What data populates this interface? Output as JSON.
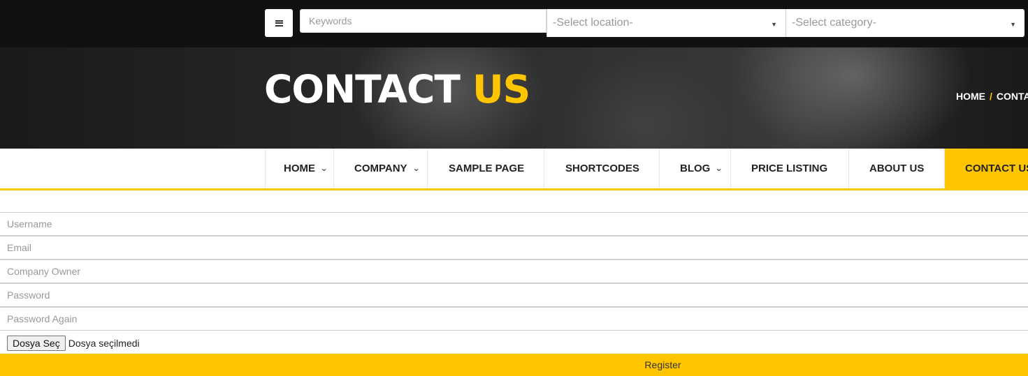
{
  "search": {
    "menu_icon": "hamburger-menu-icon",
    "keywords_placeholder": "Keywords",
    "location_selected": "-Select location-",
    "category_selected": "-Select category-"
  },
  "hero": {
    "title_main": "CONTACT",
    "title_accent": "US",
    "breadcrumb_home": "HOME",
    "breadcrumb_sep": "/",
    "breadcrumb_current": "CONTACT US"
  },
  "nav": {
    "items": [
      {
        "label": "HOME",
        "dropdown": true
      },
      {
        "label": "COMPANY",
        "dropdown": true
      },
      {
        "label": "SAMPLE PAGE",
        "dropdown": false
      },
      {
        "label": "SHORTCODES",
        "dropdown": false
      },
      {
        "label": "BLOG",
        "dropdown": true
      },
      {
        "label": "PRICE LISTING",
        "dropdown": false
      },
      {
        "label": "ABOUT US",
        "dropdown": false
      },
      {
        "label": "CONTACT US",
        "dropdown": false,
        "active": true
      }
    ]
  },
  "form": {
    "username_placeholder": "Username",
    "email_placeholder": "Email",
    "company_owner_placeholder": "Company Owner",
    "password_placeholder": "Password",
    "password_again_placeholder": "Password Again",
    "file_button": "Dosya Seç",
    "file_status": "Dosya seçilmedi",
    "register_label": "Register"
  },
  "colors": {
    "accent": "#ffc600",
    "topbar": "#111111"
  }
}
